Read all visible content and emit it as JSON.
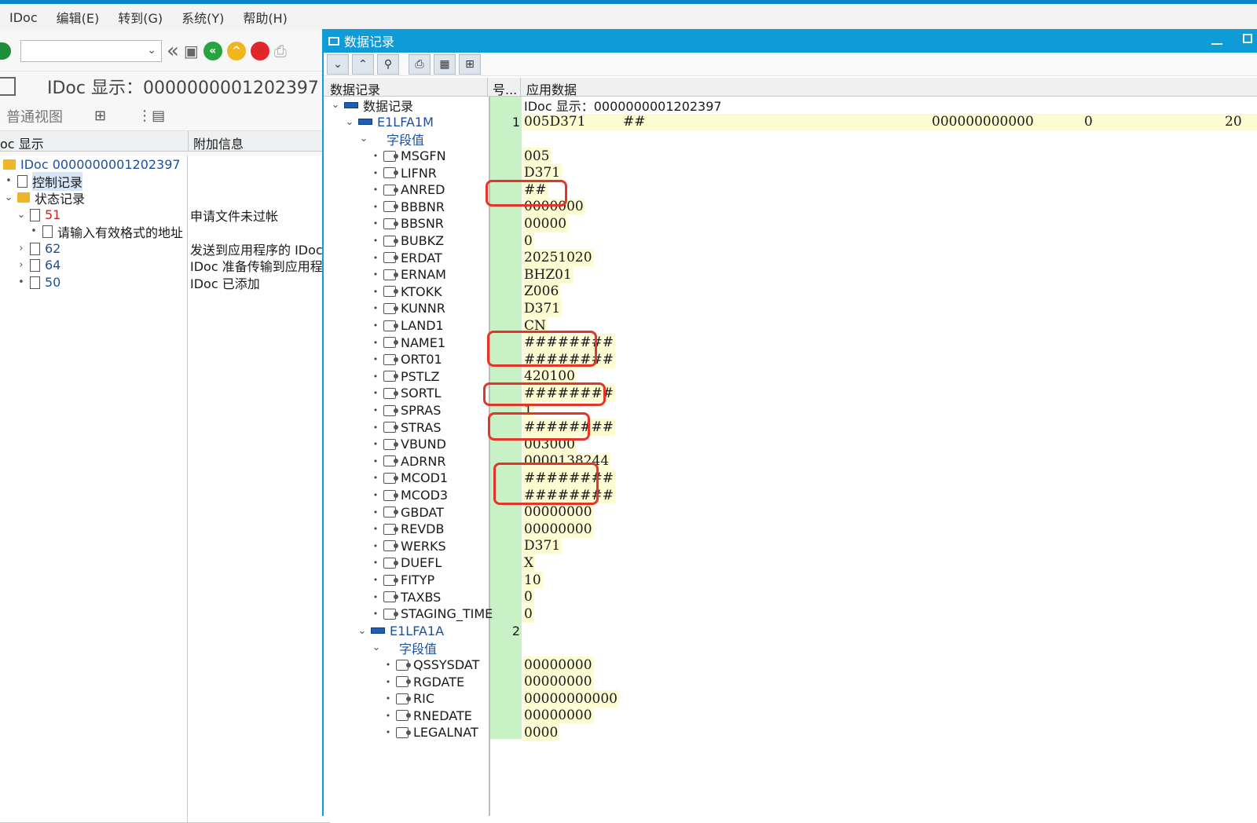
{
  "menu": [
    "IDoc",
    "编辑(E)",
    "转到(G)",
    "系统(Y)",
    "帮助(H)"
  ],
  "main": {
    "title": "IDoc 显示：0000000001202397",
    "view_label": "普通视图",
    "tree_headers": [
      "oc 显示",
      "附加信息"
    ],
    "tree": [
      {
        "text": "IDoc 0000000001202397",
        "extra": ""
      },
      {
        "text": "控制记录",
        "extra": ""
      },
      {
        "text": "状态记录",
        "extra": ""
      },
      {
        "text": "51",
        "extra": "申请文件未过帐"
      },
      {
        "text": "请输入有效格式的地址",
        "extra": ""
      },
      {
        "text": "62",
        "extra": "发送到应用程序的 IDoc"
      },
      {
        "text": "64",
        "extra": "IDoc 准备传输到应用程序"
      },
      {
        "text": "50",
        "extra": "IDoc 已添加"
      }
    ]
  },
  "popup": {
    "title": "数据记录",
    "headers": [
      "数据记录",
      "号...",
      "应用数据"
    ],
    "root_label": "数据记录",
    "root_value": "IDoc 显示：0000000001202397",
    "segment1": {
      "name": "E1LFA1M",
      "num": "1",
      "data_parts": [
        "005D371",
        "##",
        "000000000000",
        "0",
        "20"
      ]
    },
    "field_group_label": "字段值",
    "fields1": [
      {
        "name": "MSGFN",
        "value": "005"
      },
      {
        "name": "LIFNR",
        "value": "D371"
      },
      {
        "name": "ANRED",
        "value": "##"
      },
      {
        "name": "BBBNR",
        "value": "0000000"
      },
      {
        "name": "BBSNR",
        "value": "00000"
      },
      {
        "name": "BUBKZ",
        "value": "0"
      },
      {
        "name": "ERDAT",
        "value": "20251020"
      },
      {
        "name": "ERNAM",
        "value": "BHZ01"
      },
      {
        "name": "KTOKK",
        "value": "Z006"
      },
      {
        "name": "KUNNR",
        "value": "D371"
      },
      {
        "name": "LAND1",
        "value": "CN"
      },
      {
        "name": "NAME1",
        "value": "########"
      },
      {
        "name": "ORT01",
        "value": "########"
      },
      {
        "name": "PSTLZ",
        "value": "420100"
      },
      {
        "name": "SORTL",
        "value": "########"
      },
      {
        "name": "SPRAS",
        "value": "1"
      },
      {
        "name": "STRAS",
        "value": "########"
      },
      {
        "name": "VBUND",
        "value": "003000"
      },
      {
        "name": "ADRNR",
        "value": "0000138244"
      },
      {
        "name": "MCOD1",
        "value": "########"
      },
      {
        "name": "MCOD3",
        "value": "########"
      },
      {
        "name": "GBDAT",
        "value": "00000000"
      },
      {
        "name": "REVDB",
        "value": "00000000"
      },
      {
        "name": "WERKS",
        "value": "D371"
      },
      {
        "name": "DUEFL",
        "value": "X"
      },
      {
        "name": "FITYP",
        "value": "10"
      },
      {
        "name": "TAXBS",
        "value": "0"
      },
      {
        "name": "STAGING_TIME",
        "value": "0"
      }
    ],
    "segment2": {
      "name": "E1LFA1A",
      "num": "2"
    },
    "fields2": [
      {
        "name": "QSSYSDAT",
        "value": "00000000"
      },
      {
        "name": "RGDATE",
        "value": "00000000"
      },
      {
        "name": "RIC",
        "value": "00000000000"
      },
      {
        "name": "RNEDATE",
        "value": "00000000"
      },
      {
        "name": "LEGALNAT",
        "value": "0000"
      }
    ]
  },
  "colors": {
    "accent": "#0f9ad8",
    "highlight_box": "#e2362a",
    "num_col": "#c8f2c6",
    "value_bg": "#fdfbd2"
  }
}
